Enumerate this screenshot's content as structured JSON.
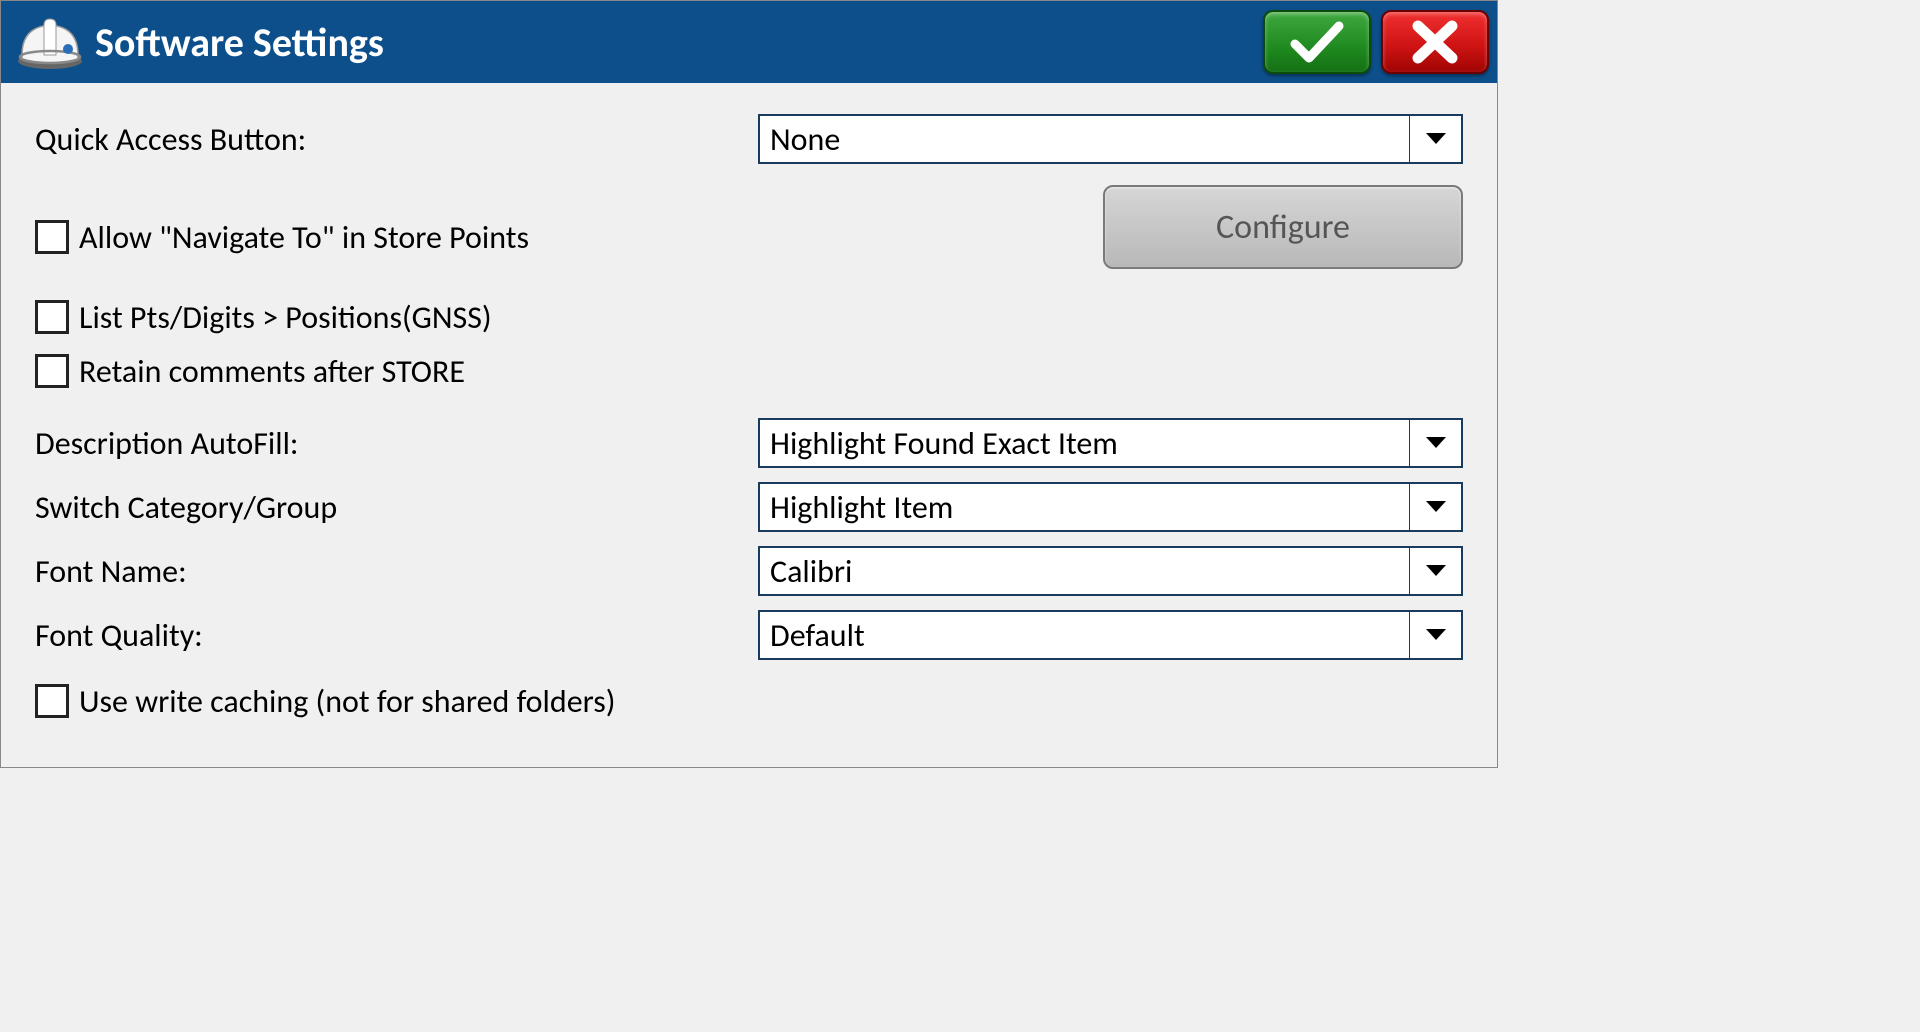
{
  "title": "Software Settings",
  "quick_access": {
    "label": "Quick Access Button:",
    "value": "None"
  },
  "allow_navigate": {
    "label": "Allow \"Navigate To\" in Store Points",
    "checked": false
  },
  "configure_label": "Configure",
  "list_pts": {
    "label": "List Pts/Digits > Positions(GNSS)",
    "checked": false
  },
  "retain_comments": {
    "label": "Retain comments after STORE",
    "checked": false
  },
  "description_autofill": {
    "label": "Description AutoFill:",
    "value": "Highlight Found Exact Item"
  },
  "switch_category": {
    "label": "Switch Category/Group",
    "value": "Highlight Item"
  },
  "font_name": {
    "label": "Font Name:",
    "value": "Calibri"
  },
  "font_quality": {
    "label": "Font Quality:",
    "value": "Default"
  },
  "write_cache": {
    "label": "Use write caching (not for shared folders)",
    "checked": false
  }
}
